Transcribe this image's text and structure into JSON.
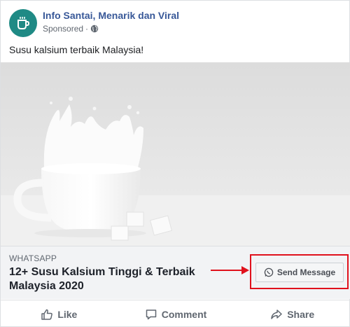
{
  "post": {
    "page_name": "Info Santai, Menarik dan Viral",
    "sponsored_label": "Sponsored",
    "separator": "·",
    "body_text": "Susu kalsium terbaik Malaysia!"
  },
  "link_preview": {
    "domain": "WHATSAPP",
    "title": "12+ Susu Kalsium Tinggi & Terbaik Malaysia 2020",
    "cta_label": "Send Message"
  },
  "actions": {
    "like_label": "Like",
    "comment_label": "Comment",
    "share_label": "Share"
  },
  "colors": {
    "brand_blue": "#385898",
    "avatar_teal": "#1f8a85",
    "annotation_red": "#e0111c",
    "muted_gray": "#606770"
  },
  "icons": [
    "coffee-cup-icon",
    "globe-icon",
    "whatsapp-icon",
    "thumbs-up-icon",
    "comment-icon",
    "share-icon"
  ]
}
